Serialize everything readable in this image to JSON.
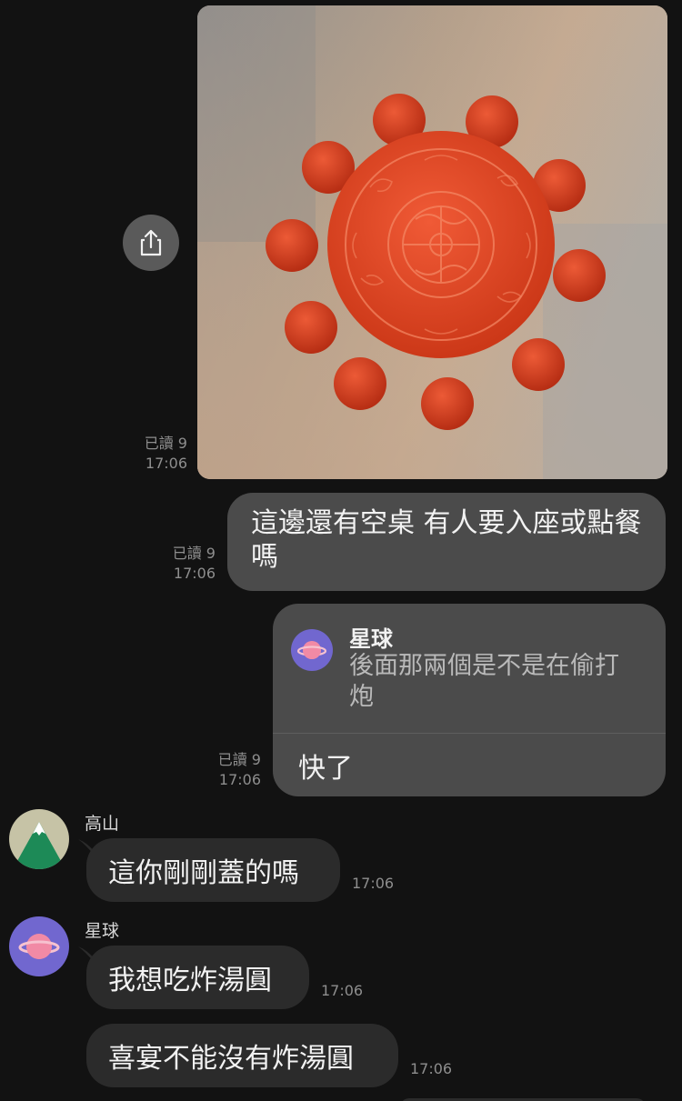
{
  "image_message": {
    "read_label": "已讀 9",
    "time": "17:06"
  },
  "message_1": {
    "text": "這邊還有空桌 有人要入座或點餐嗎",
    "read_label": "已讀 9",
    "time": "17:06"
  },
  "message_2": {
    "reply_to": {
      "name": "星球",
      "text": "後面那兩個是不是在偷打炮"
    },
    "text": "快了",
    "read_label": "已讀 9",
    "time": "17:06"
  },
  "incoming": [
    {
      "sender": "高山",
      "text": "這你剛剛蓋的嗎",
      "time": "17:06"
    },
    {
      "sender": "星球",
      "text": "我想吃炸湯圓",
      "time": "17:06"
    },
    {
      "text": "喜宴不能沒有炸湯圓",
      "time": "17:06"
    }
  ],
  "colors": {
    "background": "#121212",
    "outgoing_bubble": "#4b4b4b",
    "incoming_bubble": "#2b2b2b",
    "planet_avatar": "#7167cf",
    "mountain_avatar_bg": "#c6c3a6",
    "mountain_green": "#1d8a57"
  },
  "icons": [
    "share-icon",
    "mountain-avatar",
    "planet-avatar"
  ]
}
